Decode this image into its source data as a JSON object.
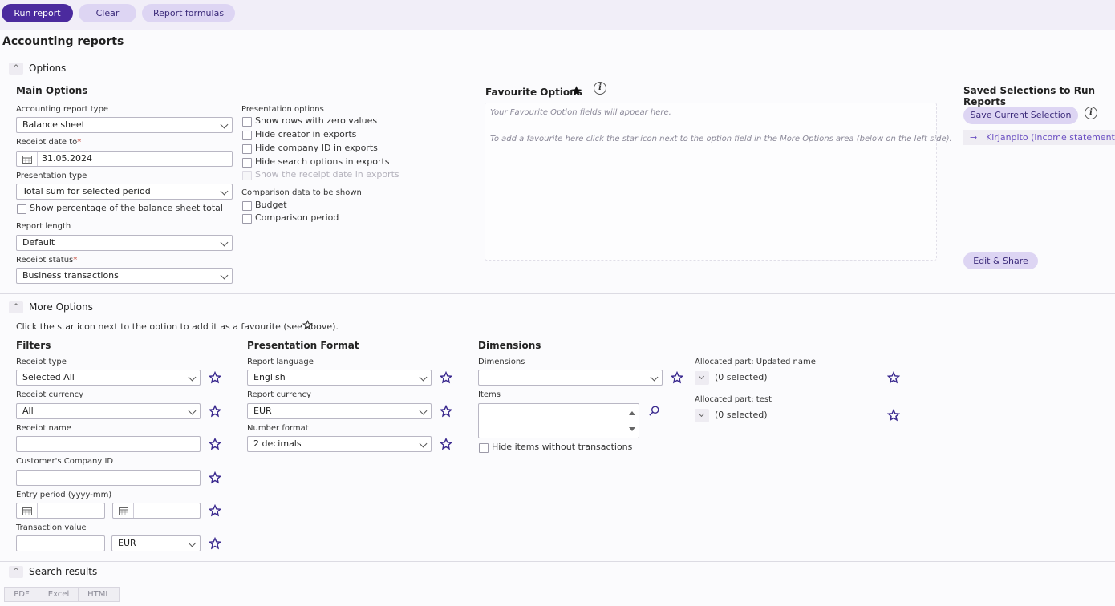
{
  "toolbar": {
    "run": "Run report",
    "clear": "Clear",
    "formulas": "Report formulas"
  },
  "page_title": "Accounting reports",
  "options": {
    "title": "Options",
    "main": {
      "heading": "Main Options",
      "report_type_label": "Accounting report type",
      "report_type_value": "Balance sheet",
      "receipt_date_label": "Receipt date to",
      "receipt_date_value": "31.05.2024",
      "presentation_type_label": "Presentation type",
      "presentation_type_value": "Total sum for selected period",
      "show_percentage": "Show percentage of the balance sheet total",
      "report_length_label": "Report length",
      "report_length_value": "Default",
      "receipt_status_label": "Receipt status",
      "receipt_status_value": "Business transactions"
    },
    "presentation": {
      "heading": "Presentation options",
      "items": [
        "Show rows with zero values",
        "Hide creator in exports",
        "Hide company ID in exports",
        "Hide search options in exports",
        "Show the receipt date in exports"
      ],
      "comparison_heading": "Comparison data to be shown",
      "comparison_items": [
        "Budget",
        "Comparison period"
      ]
    },
    "favourite": {
      "heading": "Favourite Options",
      "hint1": "Your Favourite Option fields will appear here.",
      "hint2": "To add a favourite here click the star icon next to the option field in the More Options area (below on the left side)."
    },
    "saved": {
      "heading": "Saved Selections to Run Reports",
      "save_button": "Save Current Selection",
      "link": "Kirjanpito (income statement)",
      "edit_button": "Edit & Share"
    }
  },
  "more": {
    "title": "More Options",
    "hint": "Click the star icon next to the option to add it as a favourite (see above).",
    "filters": {
      "heading": "Filters",
      "receipt_type_label": "Receipt type",
      "receipt_type_value": "Selected All",
      "receipt_currency_label": "Receipt currency",
      "receipt_currency_value": "All",
      "receipt_name_label": "Receipt name",
      "company_id_label": "Customer's Company ID",
      "entry_period_label": "Entry period (yyyy-mm)",
      "transaction_value_label": "Transaction value",
      "transaction_currency_value": "EUR"
    },
    "format": {
      "heading": "Presentation Format",
      "language_label": "Report language",
      "language_value": "English",
      "currency_label": "Report currency",
      "currency_value": "EUR",
      "number_label": "Number format",
      "number_value": "2 decimals"
    },
    "dimensions": {
      "heading": "Dimensions",
      "dimensions_label": "Dimensions",
      "items_label": "Items",
      "hide_items": "Hide items without transactions",
      "alloc1_label": "Allocated part: Updated name",
      "alloc1_value": "(0 selected)",
      "alloc2_label": "Allocated part: test",
      "alloc2_value": "(0 selected)"
    }
  },
  "search_results": {
    "title": "Search results",
    "exports": [
      "PDF",
      "Excel",
      "HTML"
    ]
  },
  "colors": {
    "primary": "#4b2a9e",
    "secondary": "#ddd5f3",
    "star": "#3b2a8f",
    "link": "#6b4fc2"
  }
}
